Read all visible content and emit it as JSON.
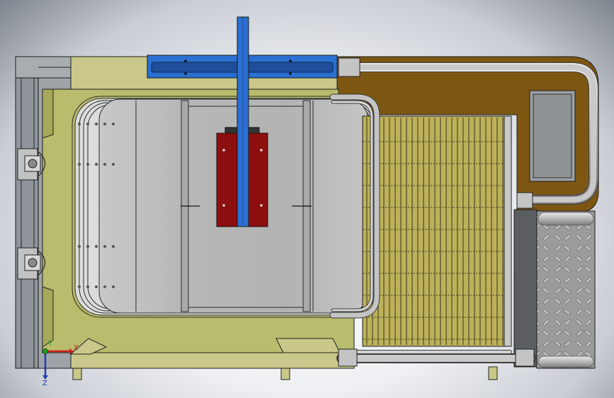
{
  "triad": {
    "x_label": "X",
    "y_label": "Y",
    "z_label": "Z"
  },
  "colors": {
    "background": "#e6e9ee",
    "frame_olive": "#c9c88a",
    "tank_olive": "#b9bc6c",
    "panel_brown": "#7d5712",
    "blue_rail": "#2b6fd1",
    "red_block": "#8c0e0e",
    "grille_yellow": "#bdb15a",
    "steel": "#b0b0b0",
    "tread_plate": "#9e9e9e"
  }
}
